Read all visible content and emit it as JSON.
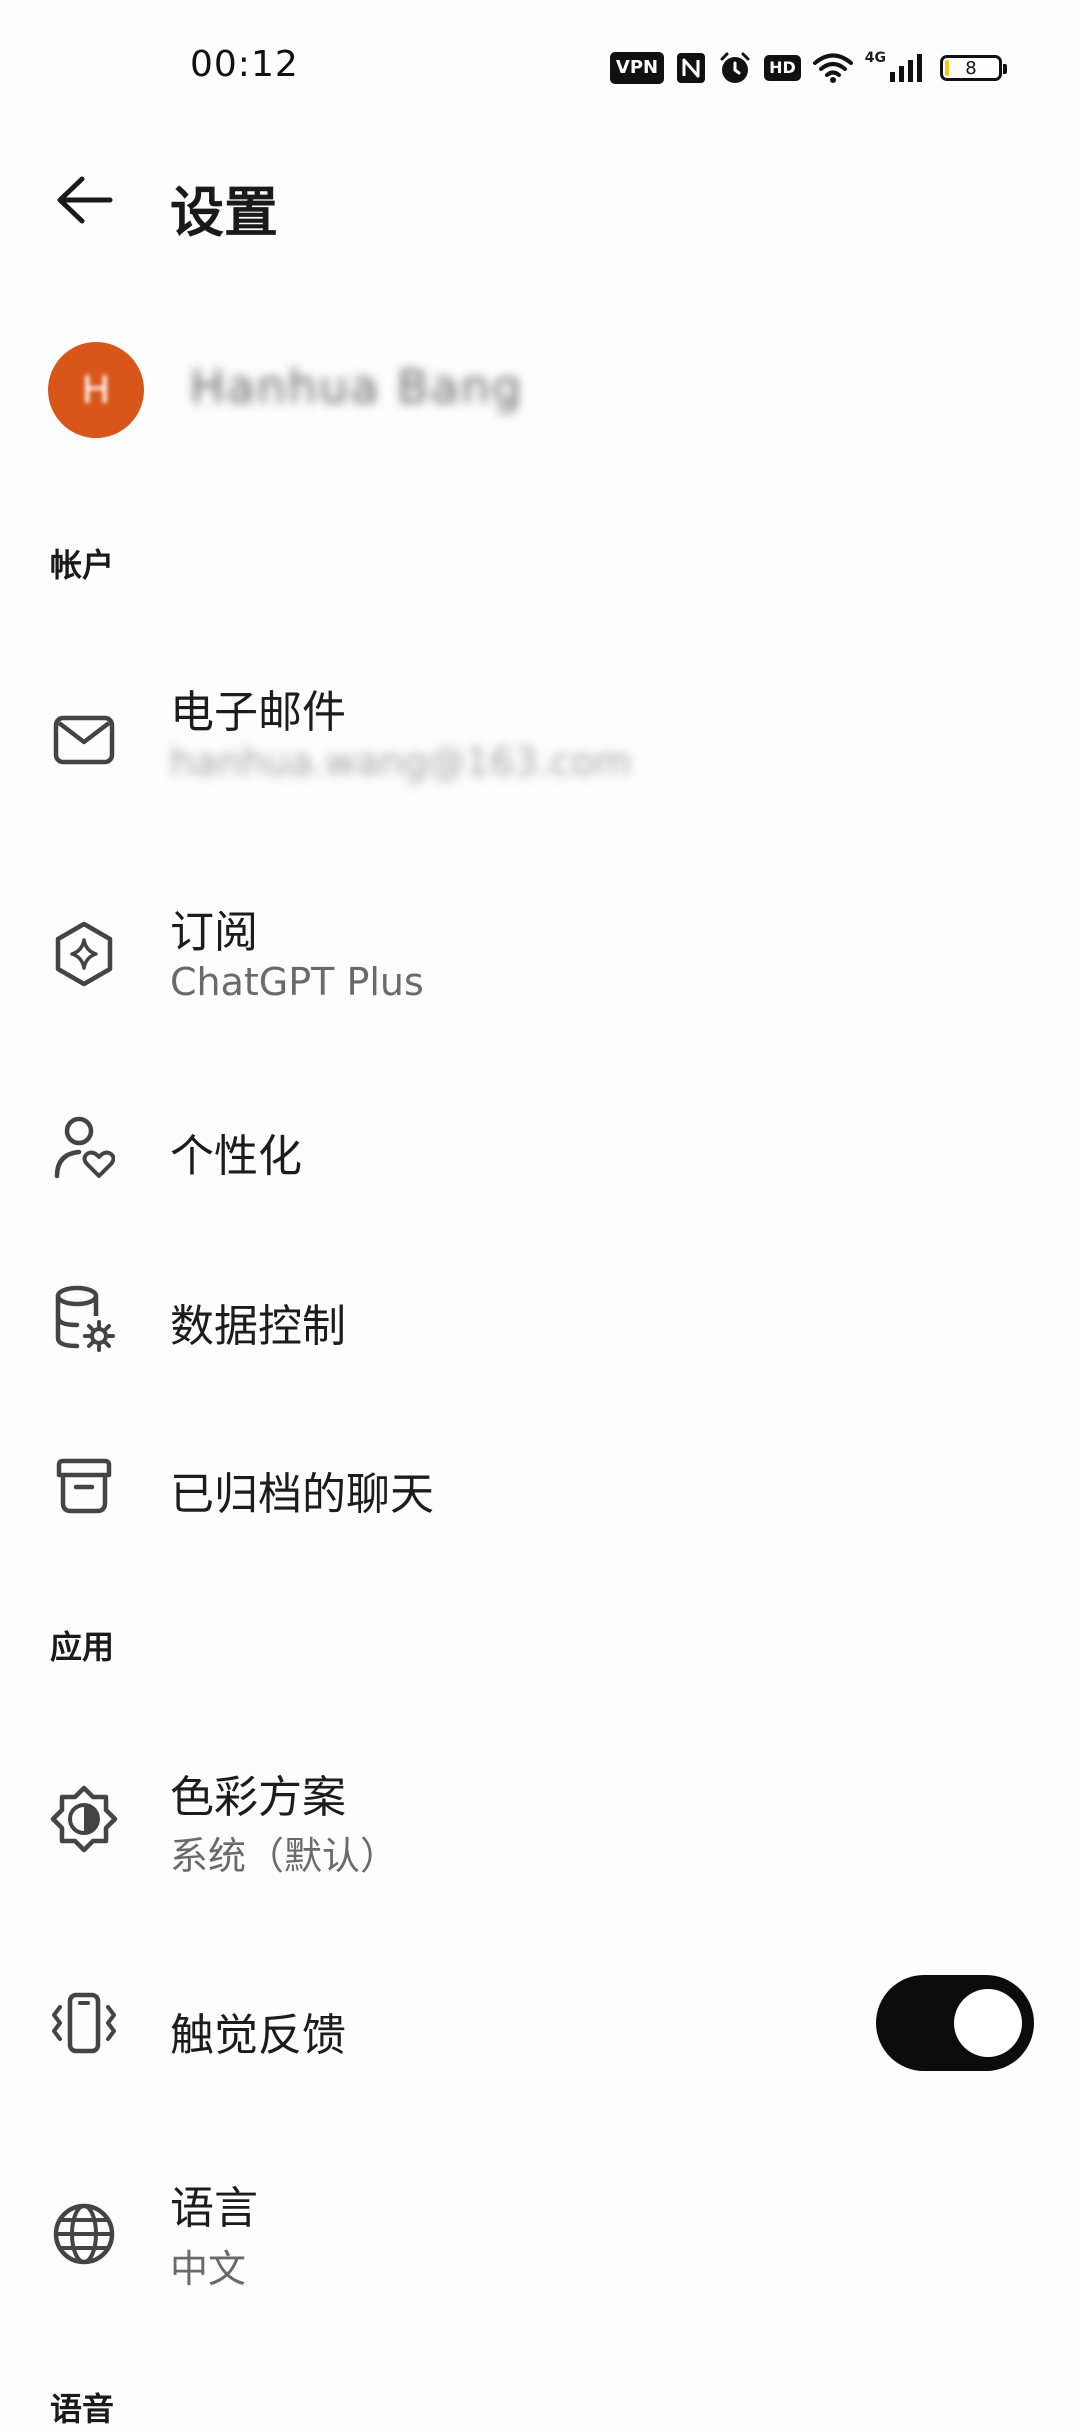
{
  "status_bar": {
    "time": "00:12",
    "vpn_label": "VPN",
    "hd_label": "HD",
    "network_label": "4G",
    "battery_level": "8",
    "battery_fraction": 0.08,
    "battery_color": "#f5c518",
    "icons": [
      "vpn-icon",
      "nfc-icon",
      "alarm-icon",
      "hd-icon",
      "wifi-icon",
      "cellular-signal-icon",
      "battery-icon"
    ]
  },
  "header": {
    "title": "设置",
    "back_icon": "arrow-left-icon"
  },
  "profile": {
    "avatar_initial": "H",
    "avatar_color": "#d9561b",
    "name": "Hanhua Bang"
  },
  "sections": {
    "account": {
      "title": "帐户",
      "items": [
        {
          "icon": "mail-icon",
          "title": "电子邮件",
          "subtitle": "hanhua.wang@163.com"
        },
        {
          "icon": "subscription-sparkle-icon",
          "title": "订阅",
          "subtitle": "ChatGPT Plus"
        },
        {
          "icon": "personalization-icon",
          "title": "个性化"
        },
        {
          "icon": "data-control-icon",
          "title": "数据控制"
        },
        {
          "icon": "archive-icon",
          "title": "已归档的聊天"
        }
      ]
    },
    "app": {
      "title": "应用",
      "items": [
        {
          "icon": "color-scheme-icon",
          "title": "色彩方案",
          "subtitle": "系统（默认）"
        },
        {
          "icon": "haptic-vibrate-icon",
          "title": "触觉反馈",
          "toggle_on": true
        },
        {
          "icon": "globe-icon",
          "title": "语言",
          "subtitle": "中文"
        }
      ]
    },
    "next": {
      "title": "语音"
    }
  }
}
